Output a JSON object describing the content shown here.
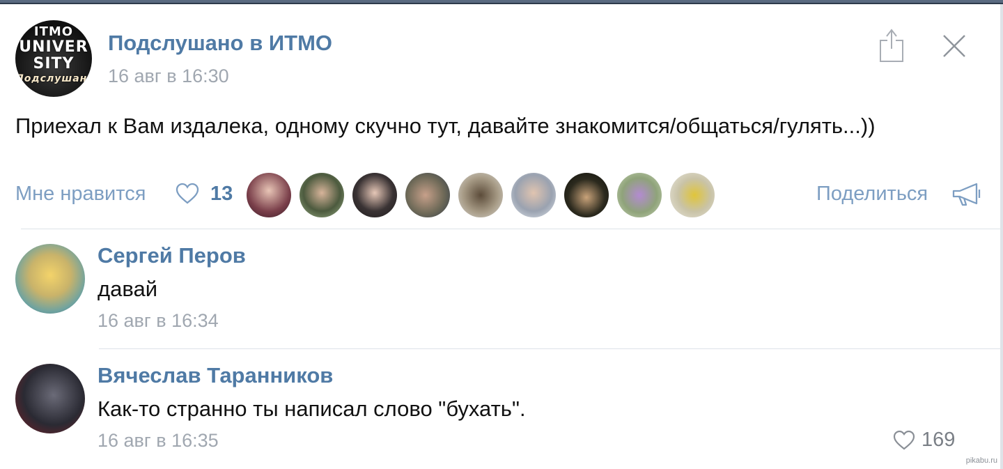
{
  "post": {
    "author": "Подслушано в ИТМО",
    "time": "16 авг в 16:30",
    "text": "Приехал к Вам издалека, одному скучно тут, давайте знакомится/общаться/гулять...))",
    "avatar_logo_lines": [
      "ITMO",
      "UNIVER",
      "SITY",
      "Подслушано"
    ],
    "like_label": "Мне нравится",
    "like_count": "13",
    "share_label": "Поделиться",
    "icons": {
      "share": "share-icon",
      "close": "close-icon",
      "like": "heart-icon",
      "megaphone": "megaphone-icon"
    },
    "likers": [
      {
        "name": "liker-1",
        "color": "#7a3f4a"
      },
      {
        "name": "liker-2",
        "color": "#5c7a4e"
      },
      {
        "name": "liker-3",
        "color": "#3a3334"
      },
      {
        "name": "liker-4",
        "color": "#6f6a58"
      },
      {
        "name": "liker-5",
        "color": "#a79b86"
      },
      {
        "name": "liker-6",
        "color": "#9aa2b0"
      },
      {
        "name": "liker-7",
        "color": "#2c2a1e"
      },
      {
        "name": "liker-8",
        "color": "#8fa37a"
      },
      {
        "name": "liker-9",
        "color": "#c9c3a7"
      }
    ]
  },
  "comments": [
    {
      "author": "Сергей Перов",
      "text": "давай",
      "time": "16 авг в 16:34",
      "avatar_color": "#c9b36a"
    },
    {
      "author": "Вячеслав Таранников",
      "text": "Как-то странно ты написал слово \"бухать\".",
      "time": "16 авг в 16:35",
      "likes": "169",
      "avatar_color": "#2a2a33"
    }
  ],
  "watermark": "pikabu.ru",
  "colors": {
    "link": "#4f7aa5",
    "muted_link": "#7d9ec2",
    "time": "#a0a7b0",
    "divider": "#dde2e8"
  }
}
